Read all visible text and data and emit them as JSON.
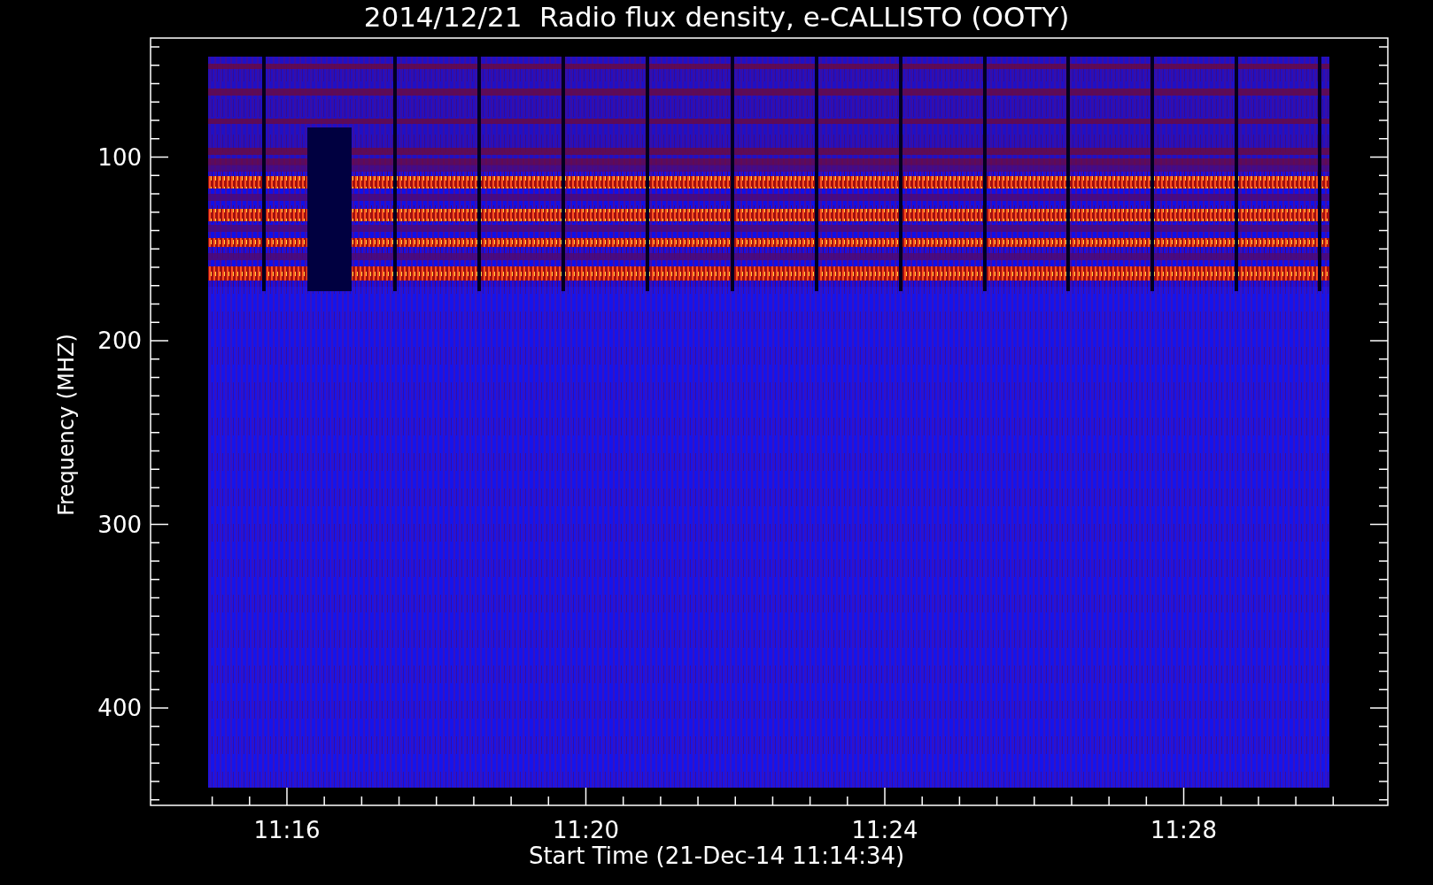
{
  "title": "2014/12/21  Radio flux density, e-CALLISTO (OOTY)",
  "y_axis": {
    "label": "Frequency (MHZ)",
    "ticks": [
      "100",
      "200",
      "300",
      "400"
    ]
  },
  "x_axis": {
    "label": "Start Time (21-Dec-14 11:14:34)",
    "ticks": [
      "11:16",
      "11:20",
      "11:24",
      "11:28"
    ]
  }
}
